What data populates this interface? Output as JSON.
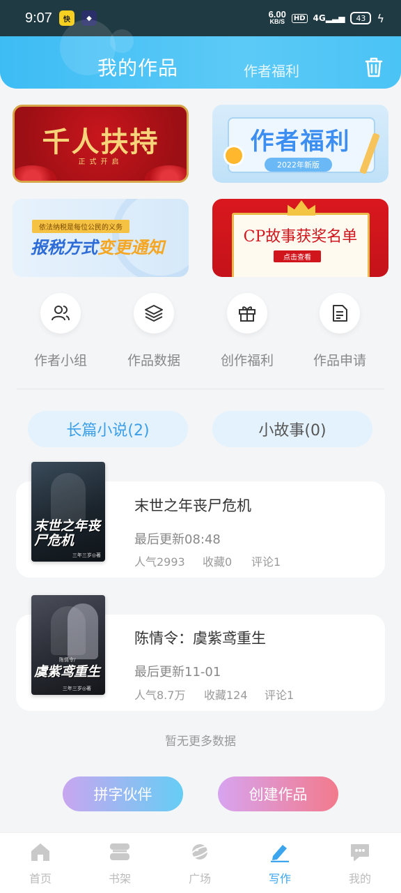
{
  "status_bar": {
    "time": "9:07",
    "app_icon_1": "快",
    "net_speed_value": "6.00",
    "net_speed_unit": "KB/S",
    "hd": "HD",
    "signal": "4G",
    "battery": "43"
  },
  "header": {
    "tab_active": "我的作品",
    "tab_other": "作者福利",
    "accent": "#3dbcf4"
  },
  "banners": {
    "b1_title": "千人扶持",
    "b1_sub": "正式开启",
    "b2_title": "作者福利",
    "b2_pill": "2022年新版",
    "b3_tag": "依法纳税是每位公民的义务",
    "b3_title_a": "报税方式",
    "b3_title_b": "变更通知",
    "b4_title": "CP故事获奖名单",
    "b4_button": "点击查看"
  },
  "quick_actions": [
    {
      "label": "作者小组",
      "icon": "users-icon"
    },
    {
      "label": "作品数据",
      "icon": "layers-icon"
    },
    {
      "label": "创作福利",
      "icon": "gift-icon"
    },
    {
      "label": "作品申请",
      "icon": "document-icon"
    }
  ],
  "categories": [
    {
      "label": "长篇小说(2)",
      "active": true
    },
    {
      "label": "小故事(0)",
      "active": false
    }
  ],
  "works": [
    {
      "title": "末世之年丧尸危机",
      "cover_title": "末世之年丧尸危机",
      "cover_author": "三年三岁◎著",
      "last_update": "最后更新08:48",
      "popularity": "人气2993",
      "favorites": "收藏0",
      "comments": "评论1"
    },
    {
      "title": "陈情令：虞紫鸢重生",
      "cover_title": "虞紫鸢重生",
      "cover_sub": "陈情令/",
      "cover_author": "三年三岁◎著",
      "last_update": "最后更新11-01",
      "popularity": "人气8.7万",
      "favorites": "收藏124",
      "comments": "评论1"
    }
  ],
  "no_more": "暂无更多数据",
  "buttons": {
    "partner": "拼字伙伴",
    "create": "创建作品"
  },
  "bottom_nav": [
    {
      "label": "首页",
      "icon": "home-icon"
    },
    {
      "label": "书架",
      "icon": "bookshelf-icon"
    },
    {
      "label": "广场",
      "icon": "planet-icon"
    },
    {
      "label": "写作",
      "icon": "pencil-icon",
      "active": true
    },
    {
      "label": "我的",
      "icon": "chat-bubble-icon"
    }
  ]
}
